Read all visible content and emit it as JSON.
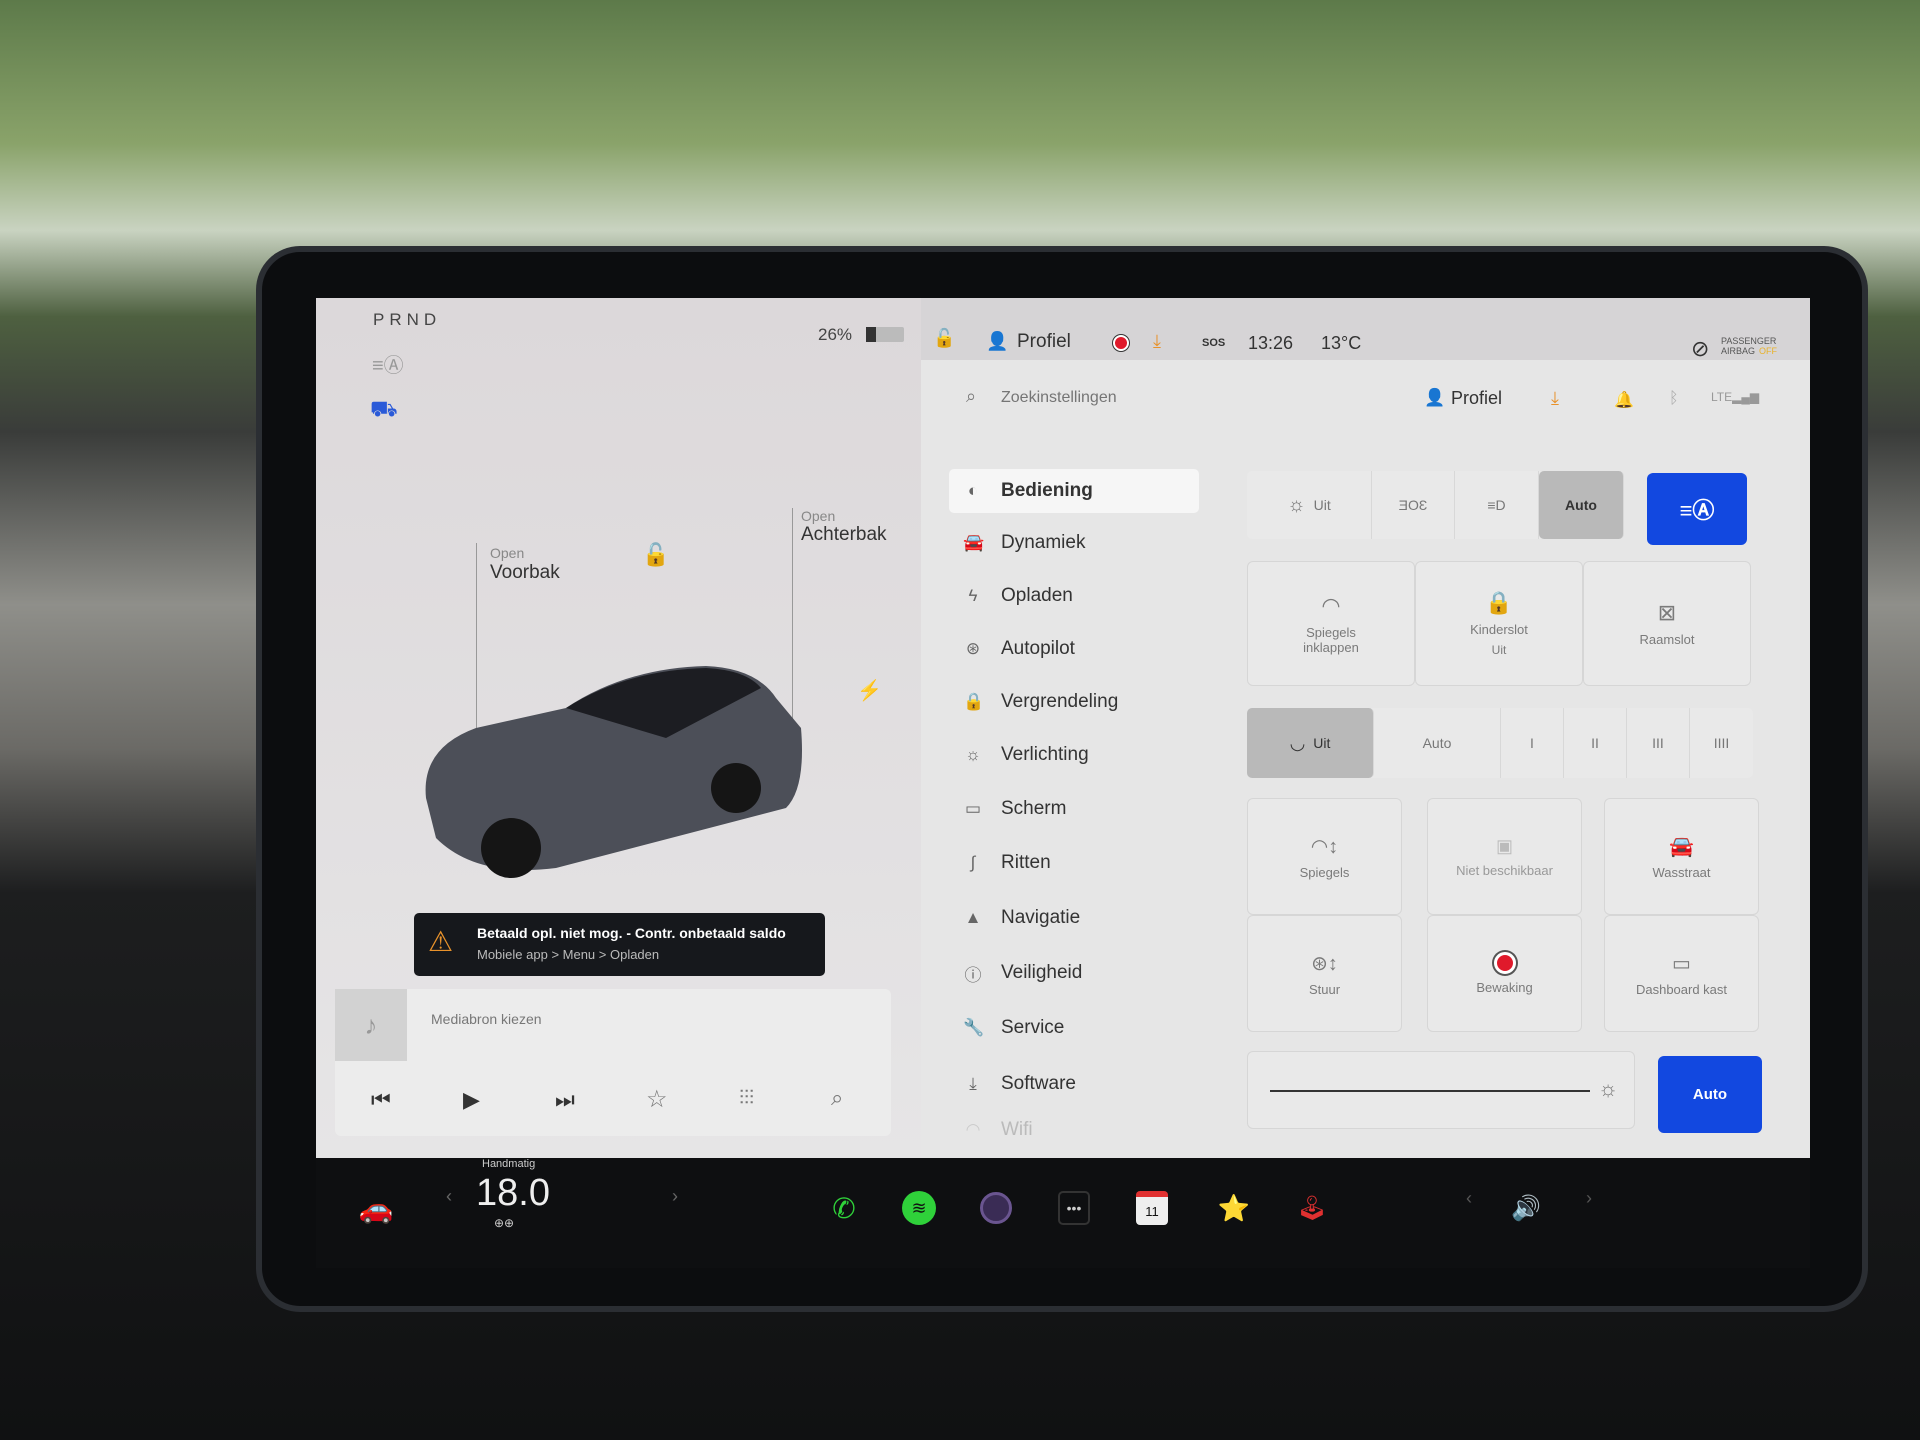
{
  "status": {
    "gear": "PRND",
    "battery": "26%",
    "battery_level": 26,
    "profile": "Profiel",
    "time": "13:26",
    "temperature": "13°C",
    "sos": "SOS",
    "airbag": "PASSENGER AIRBAG",
    "airbag_state": "OFF"
  },
  "car": {
    "frunk_action": "Open",
    "frunk": "Voorbak",
    "trunk_action": "Open",
    "trunk": "Achterbak"
  },
  "alert": {
    "title": "Betaald opl. niet mog. - Contr. onbetaald saldo",
    "subtitle": "Mobiele app > Menu > Opladen",
    "color": "#e8922b"
  },
  "media": {
    "source_label": "Mediabron kiezen"
  },
  "search": {
    "placeholder": "Zoekinstellingen",
    "profile": "Profiel"
  },
  "menu": [
    {
      "label": "Bediening",
      "icon": "toggle-icon"
    },
    {
      "label": "Dynamiek",
      "icon": "car-icon"
    },
    {
      "label": "Opladen",
      "icon": "bolt-icon"
    },
    {
      "label": "Autopilot",
      "icon": "steering-wheel-icon"
    },
    {
      "label": "Vergrendeling",
      "icon": "lock-icon"
    },
    {
      "label": "Verlichting",
      "icon": "sun-icon"
    },
    {
      "label": "Scherm",
      "icon": "display-icon"
    },
    {
      "label": "Ritten",
      "icon": "trips-icon"
    },
    {
      "label": "Navigatie",
      "icon": "navigation-icon"
    },
    {
      "label": "Veiligheid",
      "icon": "safety-icon"
    },
    {
      "label": "Service",
      "icon": "wrench-icon"
    },
    {
      "label": "Software",
      "icon": "download-icon"
    },
    {
      "label": "Wifi",
      "icon": "wifi-icon"
    }
  ],
  "lights": {
    "off": "Uit",
    "auto": "Auto",
    "selected": "Auto",
    "accent": "#1248e0"
  },
  "tiles1": [
    {
      "label": "Spiegels inklappen"
    },
    {
      "label": "Kinderslot",
      "sub": "Uit"
    },
    {
      "label": "Raamslot"
    }
  ],
  "wipers": {
    "off": "Uit",
    "auto": "Auto",
    "speeds": [
      "I",
      "II",
      "III",
      "IIII"
    ],
    "selected": "Uit"
  },
  "tiles2": [
    {
      "label": "Spiegels"
    },
    {
      "label": "Stuur"
    },
    {
      "label": "Niet beschikbaar"
    },
    {
      "label": "Bewaking"
    },
    {
      "label": "Wasstraat"
    },
    {
      "label": "Dashboard kast"
    }
  ],
  "brightness": {
    "auto": "Auto",
    "level": 100
  },
  "climate": {
    "mode": "Handmatig",
    "temp": "18.0"
  }
}
